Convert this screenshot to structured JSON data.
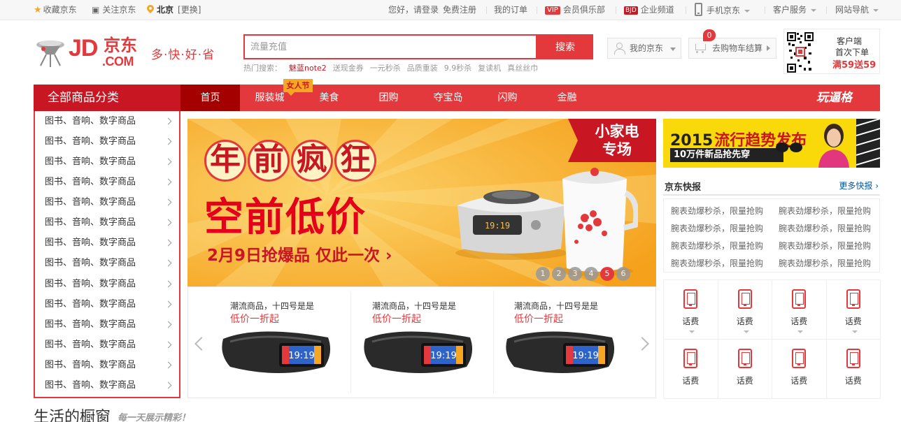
{
  "topbar": {
    "favorite": "收藏京东",
    "follow": "关注京东",
    "city": "北京",
    "change_city": "[更换]",
    "greeting": "您好，请登录",
    "register": "免费注册",
    "my_orders": "我的订单",
    "vip_badge": "VIP",
    "vip_club": "会员俱乐部",
    "bjd_badge": "BJD",
    "enterprise": "企业频道",
    "mobile_jd": "手机京东",
    "customer_service": "客户服务",
    "site_nav": "网站导航"
  },
  "header": {
    "logo_jd": "JD",
    "logo_cn": "京东",
    "logo_com": ".COM",
    "slogan": "多·快·好·省",
    "search_placeholder": "流量充值",
    "search_button": "搜索",
    "hot_label": "热门搜索：",
    "hot_items": [
      "魅蓝note2",
      "送现金券",
      "一元秒杀",
      "品质重装",
      "9.9秒杀",
      "复读机",
      "真丝丝巾"
    ],
    "my_jd": "我的京东",
    "cart_label": "去购物车结算",
    "cart_count": "0",
    "qr_line1": "客户端",
    "qr_line2": "首次下单",
    "qr_line3": "满59送59"
  },
  "nav": {
    "all_categories": "全部商品分类",
    "links": [
      "首页",
      "服装城",
      "美食",
      "团购",
      "夺宝岛",
      "闪购",
      "金融"
    ],
    "women_tag": "女人节",
    "fun": "玩逼格"
  },
  "categories": [
    "图书、音响、数字商品",
    "图书、音响、数字商品",
    "图书、音响、数字商品",
    "图书、音响、数字商品",
    "图书、音响、数字商品",
    "图书、音响、数字商品",
    "图书、音响、数字商品",
    "图书、音响、数字商品",
    "图书、音响、数字商品",
    "图书、音响、数字商品",
    "图书、音响、数字商品",
    "图书、音响、数字商品",
    "图书、音响、数字商品",
    "图书、音响、数字商品"
  ],
  "banner": {
    "line1": [
      "年",
      "前",
      "疯",
      "狂"
    ],
    "line2": "空前低价",
    "line3": "2月9日抢爆品 仅此一次",
    "badge_line1": "小家电",
    "badge_line2": "专场",
    "dots": [
      "1",
      "2",
      "3",
      "4",
      "5",
      "6"
    ],
    "active_dot": "5",
    "cooker_display": "19:19"
  },
  "products": [
    {
      "title": "潮流商品，十四号是是",
      "promo": "低价一折起",
      "display": "19:19"
    },
    {
      "title": "潮流商品，十四号是是",
      "promo": "低价一折起",
      "display": "19:19"
    },
    {
      "title": "潮流商品，十四号是是",
      "promo": "低价一折起",
      "display": "19:19"
    }
  ],
  "ad": {
    "year": "2015",
    "headline": "流行趋势发布",
    "sub": "10万件新品抢先穿"
  },
  "news": {
    "title": "京东快报",
    "more": "更多快报 ›",
    "items": [
      "腕表劲爆秒杀，限量抢购",
      "腕表劲爆秒杀，限量抢购",
      "腕表劲爆秒杀，限量抢购",
      "腕表劲爆秒杀，限量抢购",
      "腕表劲爆秒杀，限量抢购",
      "腕表劲爆秒杀，限量抢购",
      "腕表劲爆秒杀，限量抢购",
      "腕表劲爆秒杀，限量抢购"
    ]
  },
  "services": [
    "话费",
    "话费",
    "话费",
    "话费",
    "话费",
    "话费",
    "话费",
    "话费"
  ],
  "life": {
    "title": "生活的橱窗",
    "subtitle": "每一天展示精彩！"
  },
  "colors": {
    "brand_red": "#e4393c",
    "dark_red": "#c81623",
    "banner_yellow": "#f9b233",
    "ad_yellow": "#f9d90a"
  }
}
